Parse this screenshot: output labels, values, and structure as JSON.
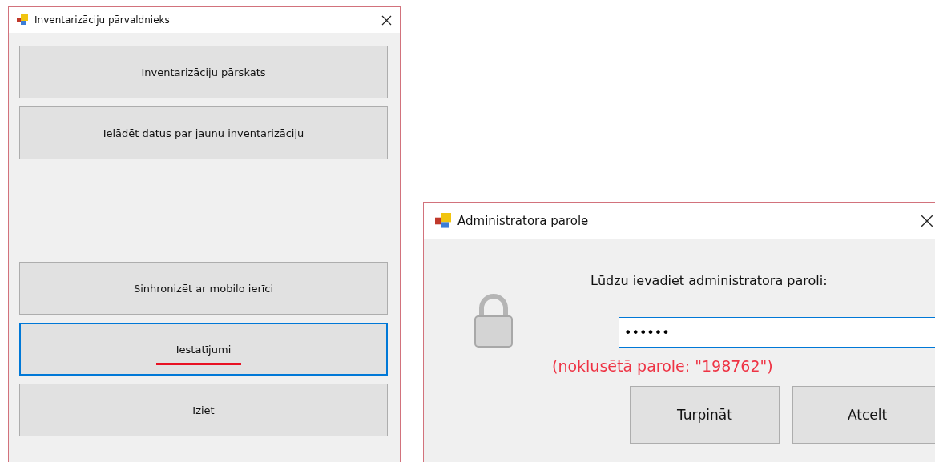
{
  "main_window": {
    "title": "Inventarizāciju pārvaldnieks",
    "top_buttons": [
      {
        "label": "Inventarizāciju pārskats",
        "focused": false,
        "underlined": false
      },
      {
        "label": "Ielādēt datus par jaunu inventarizāciju",
        "focused": false,
        "underlined": false
      }
    ],
    "bottom_buttons": [
      {
        "label": "Sinhronizēt ar mobilo ierīci",
        "focused": false,
        "underlined": false
      },
      {
        "label": "Iestatījumi",
        "focused": true,
        "underlined": true
      },
      {
        "label": "Iziet",
        "focused": false,
        "underlined": false
      }
    ]
  },
  "password_dialog": {
    "title": "Administratora parole",
    "prompt": "Lūdzu ievadiet administratora paroli:",
    "password_value": "••••••",
    "hint": "(noklusētā parole: \"198762\")",
    "buttons": [
      {
        "label": "Turpināt"
      },
      {
        "label": "Atcelt"
      }
    ]
  }
}
